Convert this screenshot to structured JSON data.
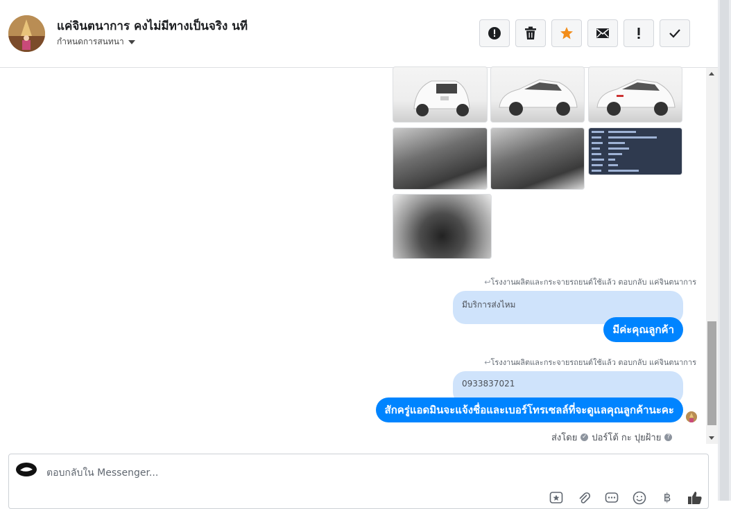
{
  "header": {
    "title": "แค่จินตนาการ คงไม่มีทางเป็นจริง นที",
    "subtitle": "กำหนดการสนทนา",
    "actions": [
      {
        "name": "report-button",
        "icon": "alert-circle-icon"
      },
      {
        "name": "delete-button",
        "icon": "trash-icon"
      },
      {
        "name": "star-button",
        "icon": "star-icon"
      },
      {
        "name": "mail-button",
        "icon": "envelope-icon"
      },
      {
        "name": "important-button",
        "icon": "exclamation-icon"
      },
      {
        "name": "done-button",
        "icon": "checkmark-icon"
      }
    ]
  },
  "colors": {
    "accent": "#0084ff",
    "quoted_bg": "#cfe3fb",
    "star": "#f28d1b"
  },
  "conversation": {
    "reply1": {
      "meta": "โรงงานผลิตและกระจายรถยนต์ใช้แล้ว ตอบกลับ แค่จินตนาการ",
      "quoted": "มีบริการส่งไหม",
      "message": "มีค่ะคุณลูกค้า"
    },
    "reply2": {
      "meta": "โรงงานผลิตและกระจายรถยนต์ใช้แล้ว ตอบกลับ แค่จินตนาการ",
      "quoted": "0933837021",
      "message": "สักครู่แอดมินจะแจ้งชื่อและเบอร์โทรเซลล์ที่จะดูแลคุณลูกค้านะคะ"
    },
    "sent_by_label": "ส่งโดย",
    "sent_by_name": "ปอร์โต้ กะ ปุยฝ้าย"
  },
  "composer": {
    "placeholder": "ตอบกลับใน Messenger...",
    "tools": [
      "saved-reply-icon",
      "attachment-icon",
      "chat-options-icon",
      "emoji-icon",
      "payment-icon",
      "like-icon"
    ],
    "payment_symbol": "฿"
  }
}
